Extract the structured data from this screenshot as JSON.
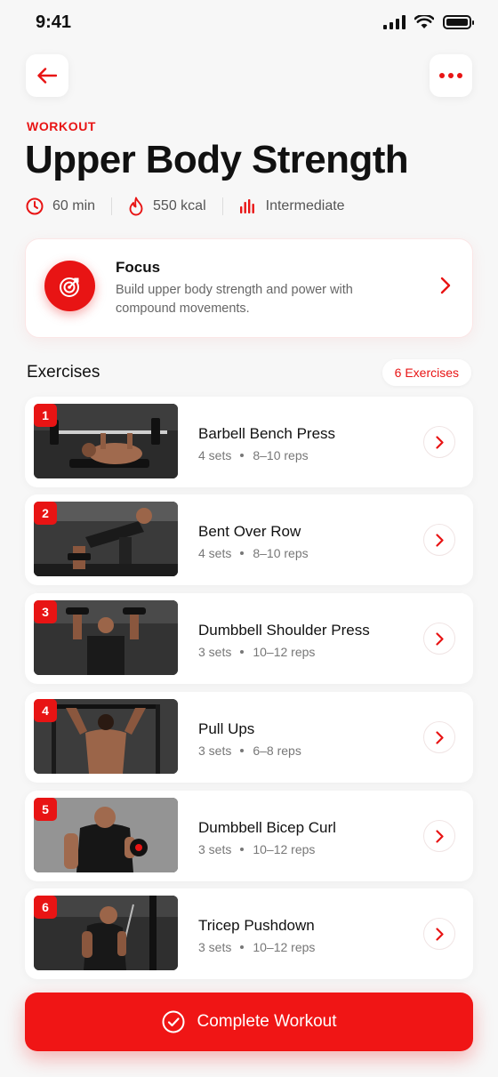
{
  "status_bar": {
    "time": "9:41"
  },
  "header": {
    "eyebrow": "WORKOUT",
    "title": "Upper Body Strength",
    "meta": [
      {
        "icon": "clock-icon",
        "label": "60 min"
      },
      {
        "icon": "flame-icon",
        "label": "550 kcal"
      },
      {
        "icon": "intensity-bars-icon",
        "label": "Intermediate"
      }
    ]
  },
  "focus": {
    "title": "Focus",
    "description": "Build upper body strength and power with compound movements.",
    "icon": "target-icon"
  },
  "exercises_section": {
    "title": "Exercises",
    "count_label": "6 Exercises"
  },
  "exercises": [
    {
      "number": "1",
      "name": "Barbell Bench Press",
      "sets": "4 sets",
      "reps": "8–10 reps"
    },
    {
      "number": "2",
      "name": "Bent Over Row",
      "sets": "4 sets",
      "reps": "8–10 reps"
    },
    {
      "number": "3",
      "name": "Dumbbell Shoulder Press",
      "sets": "3 sets",
      "reps": "10–12 reps"
    },
    {
      "number": "4",
      "name": "Pull Ups",
      "sets": "3 sets",
      "reps": "6–8 reps"
    },
    {
      "number": "5",
      "name": "Dumbbell Bicep Curl",
      "sets": "3 sets",
      "reps": "10–12 reps"
    },
    {
      "number": "6",
      "name": "Tricep Pushdown",
      "sets": "3 sets",
      "reps": "10–12 reps"
    }
  ],
  "complete_button": {
    "label": "Complete Workout",
    "icon": "check-circle-icon"
  },
  "colors": {
    "accent": "#e81414",
    "background": "#f7f7f7",
    "card": "#ffffff"
  }
}
